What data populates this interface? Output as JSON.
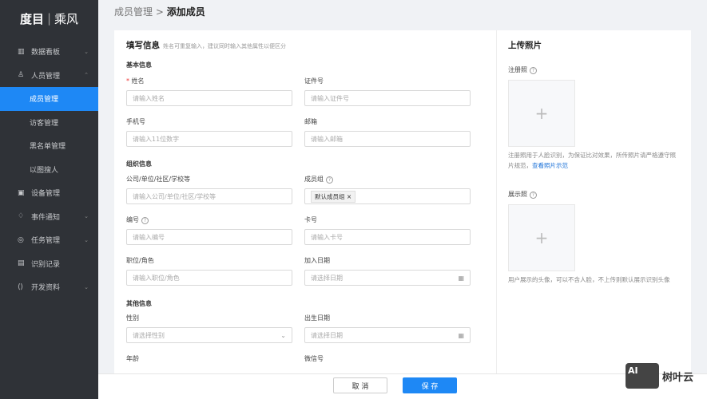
{
  "sidebar": {
    "logo_main": "度目",
    "logo_sub": "乘风",
    "items": [
      {
        "label": "数据看板",
        "icon": "chart-icon",
        "chev": "⌄"
      },
      {
        "label": "人员管理",
        "icon": "person-icon",
        "chev": "⌃"
      },
      {
        "label": "成员管理"
      },
      {
        "label": "访客管理"
      },
      {
        "label": "黑名单管理"
      },
      {
        "label": "以图搜人"
      },
      {
        "label": "设备管理",
        "icon": "device-icon"
      },
      {
        "label": "事件通知",
        "icon": "bell-icon",
        "chev": "⌄"
      },
      {
        "label": "任务管理",
        "icon": "task-icon",
        "chev": "⌄"
      },
      {
        "label": "识别记录",
        "icon": "record-icon"
      },
      {
        "label": "开发资料",
        "icon": "dev-icon",
        "chev": "⌄"
      }
    ]
  },
  "breadcrumb": {
    "parent": "成员管理",
    "sep": ">",
    "current": "添加成员"
  },
  "form": {
    "title": "填写信息",
    "subtitle": "姓名可重复输入，建议同时输入其他属性以便区分",
    "sections": {
      "basic": "基本信息",
      "org": "组织信息",
      "other": "其他信息"
    },
    "fields": {
      "name": {
        "label": "姓名",
        "placeholder": "请输入姓名"
      },
      "id": {
        "label": "证件号",
        "placeholder": "请输入证件号"
      },
      "phone": {
        "label": "手机号",
        "placeholder": "请输入11位数字"
      },
      "email": {
        "label": "邮箱",
        "placeholder": "请输入邮箱"
      },
      "company": {
        "label": "公司/单位/社区/学校等",
        "placeholder": "请输入公司/单位/社区/学校等"
      },
      "group": {
        "label": "成员组",
        "tag": "默认成员组"
      },
      "number": {
        "label": "编号",
        "placeholder": "请输入编号"
      },
      "card": {
        "label": "卡号",
        "placeholder": "请输入卡号"
      },
      "role": {
        "label": "职位/角色",
        "placeholder": "请输入职位/角色"
      },
      "join": {
        "label": "加入日期",
        "placeholder": "请选择日期"
      },
      "gender": {
        "label": "性别",
        "placeholder": "请选择性别"
      },
      "birth": {
        "label": "出生日期",
        "placeholder": "请选择日期"
      },
      "age": {
        "label": "年龄"
      },
      "wechat": {
        "label": "微信号"
      }
    }
  },
  "photos": {
    "title": "上传照片",
    "register_label": "注册照",
    "register_hint": "注册照用于人脸识别，为保证比对效果，所传照片请严格遵守照片规范，",
    "register_link": "查看照片示范",
    "display_label": "展示照",
    "display_hint": "用户展示的头像，可以不含人脸，不上传则默认展示识别头像"
  },
  "footer": {
    "cancel": "取 消",
    "save": "保 存"
  },
  "watermark": {
    "text": "树叶云",
    "badge": "AI"
  }
}
